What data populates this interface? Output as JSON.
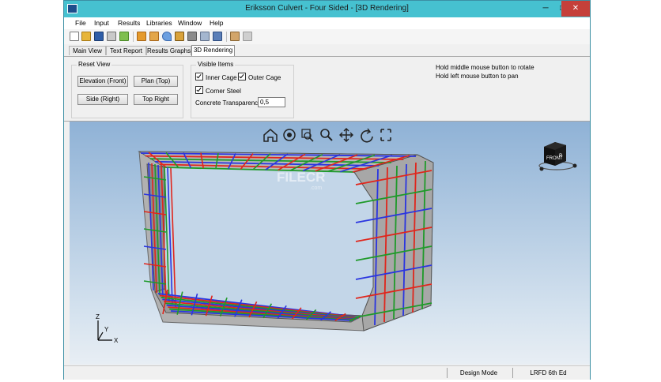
{
  "window": {
    "title": "Eriksson Culvert - Four Sided - [3D Rendering]",
    "controls": {
      "minimize": "─",
      "maximize": "□",
      "close": "✕"
    },
    "titlebar_color": "#46c1d0"
  },
  "menu": [
    "File",
    "Input",
    "Results",
    "Libraries",
    "Window",
    "Help"
  ],
  "toolbar_icons": [
    "new-icon",
    "open-icon",
    "save-icon",
    "print-icon",
    "export-icon",
    "culvert-icon",
    "load-icon",
    "marker-icon",
    "report-icon",
    "tools-icon",
    "section-icon",
    "frame-icon",
    "elevation-icon",
    "plan-icon"
  ],
  "tabs": [
    "Main View",
    "Text Report",
    "Results Graphs",
    "3D Rendering"
  ],
  "active_tab": "3D Rendering",
  "reset_view": {
    "label": "Reset View",
    "buttons": [
      "Elevation (Front)",
      "Plan (Top)",
      "Side (Right)",
      "Top Right"
    ]
  },
  "visible_items": {
    "label": "Visible Items",
    "inner_cage": {
      "label": "Inner Cage",
      "checked": true
    },
    "outer_cage": {
      "label": "Outer Cage",
      "checked": true
    },
    "corner_steel": {
      "label": "Corner Steel",
      "checked": true
    },
    "transparency_label": "Concrete Transparency:",
    "transparency_value": "0,5"
  },
  "hints": [
    "Hold middle mouse button to rotate",
    "Hold left mouse button to pan"
  ],
  "viewport": {
    "nav_icons": [
      "home-icon",
      "look-icon",
      "zoom-window-icon",
      "zoom-icon",
      "pan-icon",
      "rotate-icon",
      "fit-icon"
    ],
    "viewcube": {
      "face_label": "FRONT",
      "side_label": "R"
    },
    "axes": {
      "x": "X",
      "y": "Y",
      "z": "Z"
    },
    "watermark": "FILECR",
    "watermark_sub": ".com",
    "colors": {
      "rebar_blue": "#2a35e0",
      "rebar_red": "#e0261c",
      "rebar_green": "#1f9a2a",
      "concrete": "#9c9c9c"
    }
  },
  "status": {
    "mode": "Design Mode",
    "code": "LRFD 6th Ed"
  }
}
